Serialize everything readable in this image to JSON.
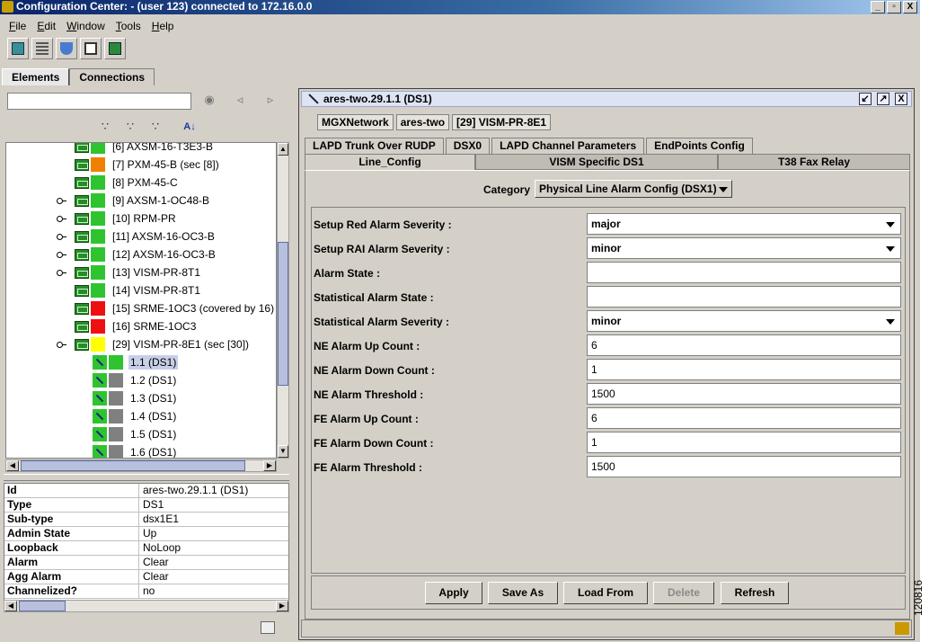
{
  "window": {
    "title": "Configuration Center: - (user 123) connected to 172.16.0.0",
    "controls": [
      "_",
      "▫",
      "X"
    ]
  },
  "menu": [
    {
      "key": "F",
      "rest": "ile"
    },
    {
      "key": "E",
      "rest": "dit"
    },
    {
      "key": "W",
      "rest": "indow"
    },
    {
      "key": "T",
      "rest": "ools"
    },
    {
      "key": "H",
      "rest": "elp"
    }
  ],
  "toolbar_icons": [
    "cube-icon",
    "shelf-icon",
    "shield-icon",
    "copy-icon",
    "export-icon"
  ],
  "main_tabs": [
    "Elements",
    "Connections"
  ],
  "tree": {
    "rows": [
      {
        "label": "[6] AXSM-16-T3E3-B",
        "status": "#2fc42f"
      },
      {
        "label": "[7] PXM-45-B (sec [8])",
        "status": "#f08000"
      },
      {
        "label": "[8] PXM-45-C",
        "status": "#2fc42f"
      },
      {
        "label": "[9] AXSM-1-OC48-B",
        "status": "#2fc42f"
      },
      {
        "label": "[10] RPM-PR",
        "status": "#2fc42f"
      },
      {
        "label": "[11] AXSM-16-OC3-B",
        "status": "#2fc42f"
      },
      {
        "label": "[12] AXSM-16-OC3-B",
        "status": "#2fc42f"
      },
      {
        "label": "[13] VISM-PR-8T1",
        "status": "#2fc42f"
      },
      {
        "label": "[14] VISM-PR-8T1",
        "status": "#2fc42f"
      },
      {
        "label": "[15] SRME-1OC3 (covered by 16)",
        "status": "#ee1010"
      },
      {
        "label": "[16] SRME-1OC3",
        "status": "#ee1010"
      },
      {
        "label": "[29] VISM-PR-8E1 (sec [30])",
        "status": "#ffff00"
      },
      {
        "label": "1.1  (DS1)",
        "status": "#2fc42f"
      },
      {
        "label": "1.2  (DS1)",
        "status": "#808080"
      },
      {
        "label": "1.3  (DS1)",
        "status": "#808080"
      },
      {
        "label": "1.4  (DS1)",
        "status": "#808080"
      },
      {
        "label": "1.5  (DS1)",
        "status": "#808080"
      },
      {
        "label": "1.6  (DS1)",
        "status": "#808080"
      }
    ]
  },
  "properties": [
    {
      "key": "Id",
      "value": "ares-two.29.1.1  (DS1)"
    },
    {
      "key": "Type",
      "value": "DS1"
    },
    {
      "key": "Sub-type",
      "value": "dsx1E1"
    },
    {
      "key": "Admin State",
      "value": "Up"
    },
    {
      "key": "Loopback",
      "value": "NoLoop"
    },
    {
      "key": "Alarm",
      "value": "Clear"
    },
    {
      "key": "Agg Alarm",
      "value": "Clear"
    },
    {
      "key": "Channelized?",
      "value": "no"
    }
  ],
  "panel": {
    "title": "ares-two.29.1.1  (DS1)",
    "breadcrumb": [
      "MGXNetwork",
      "ares-two",
      "[29] VISM-PR-8E1"
    ],
    "tabs_row1": [
      "LAPD Trunk Over RUDP",
      "DSX0",
      "LAPD Channel Parameters",
      "EndPoints Config"
    ],
    "tabs_row2": [
      "Line_Config",
      "VISM Specific DS1",
      "T38 Fax Relay"
    ],
    "category_label": "Category",
    "category_value": "Physical Line Alarm Config (DSX1)",
    "fields": [
      {
        "label": "Setup Red Alarm Severity :",
        "value": "major",
        "dropdown": true
      },
      {
        "label": "Setup RAI Alarm Severity :",
        "value": "minor",
        "dropdown": true
      },
      {
        "label": "Alarm State :",
        "value": "",
        "dropdown": false
      },
      {
        "label": "Statistical Alarm State :",
        "value": "",
        "dropdown": false
      },
      {
        "label": "Statistical Alarm Severity :",
        "value": "minor",
        "dropdown": true
      },
      {
        "label": "NE Alarm Up Count :",
        "value": "6",
        "dropdown": false
      },
      {
        "label": "NE Alarm Down Count :",
        "value": "1",
        "dropdown": false
      },
      {
        "label": "NE Alarm Threshold :",
        "value": "1500",
        "dropdown": false
      },
      {
        "label": "FE Alarm Up Count :",
        "value": "6",
        "dropdown": false
      },
      {
        "label": "FE Alarm Down Count :",
        "value": "1",
        "dropdown": false
      },
      {
        "label": "FE Alarm Threshold :",
        "value": "1500",
        "dropdown": false
      }
    ],
    "buttons": [
      {
        "label": "Apply",
        "enabled": true
      },
      {
        "label": "Save As",
        "enabled": true
      },
      {
        "label": "Load From",
        "enabled": true
      },
      {
        "label": "Delete",
        "enabled": false
      },
      {
        "label": "Refresh",
        "enabled": true
      }
    ]
  },
  "figure_number": "120816"
}
